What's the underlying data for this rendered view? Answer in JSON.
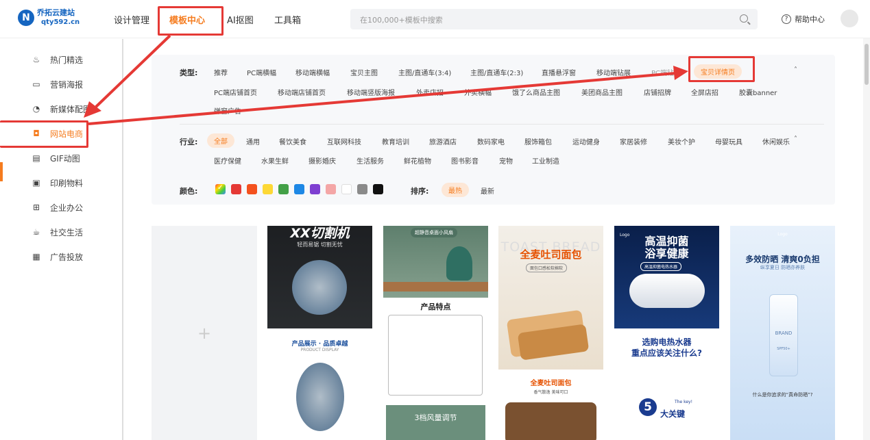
{
  "header": {
    "logo_name": "乔拓云建站",
    "logo_url": "qty592.cn",
    "nav": [
      "设计管理",
      "模板中心",
      "AI抠图",
      "工具箱"
    ],
    "search_placeholder": "在100,000+模板中搜索",
    "help_label": "帮助中心"
  },
  "sidebar": {
    "items": [
      {
        "label": "热门精选",
        "icon": "fire-icon"
      },
      {
        "label": "营销海报",
        "icon": "poster-icon"
      },
      {
        "label": "新媒体配图",
        "icon": "chat-icon"
      },
      {
        "label": "网站电商",
        "icon": "shop-icon"
      },
      {
        "label": "GIF动图",
        "icon": "gif-icon"
      },
      {
        "label": "印刷物料",
        "icon": "print-icon"
      },
      {
        "label": "企业办公",
        "icon": "office-icon"
      },
      {
        "label": "社交生活",
        "icon": "social-icon"
      },
      {
        "label": "广告投放",
        "icon": "ad-icon"
      }
    ],
    "active": "网站电商"
  },
  "filters": {
    "type_label": "类型:",
    "types_row1": [
      "推荐",
      "PC端横幅",
      "移动端横幅",
      "宝贝主图",
      "主图/直通车(3:4)",
      "主图/直通车(2:3)",
      "直播悬浮窗",
      "移动端钻展",
      "PC端钻展",
      "宝贝详情页"
    ],
    "types_row2": [
      "PC端店铺首页",
      "移动端店铺首页",
      "移动端竖版海报",
      "外卖店招",
      "外卖横幅",
      "饿了么商品主图",
      "美团商品主图",
      "店铺招牌",
      "全屏店招",
      "胶囊banner"
    ],
    "types_row3": [
      "弹窗广告"
    ],
    "type_selected": "宝贝详情页",
    "industry_label": "行业:",
    "industries_row1": [
      "全部",
      "通用",
      "餐饮美食",
      "互联网科技",
      "教育培训",
      "旅游酒店",
      "数码家电",
      "服饰箱包",
      "运动健身",
      "家居装修",
      "美妆个护",
      "母婴玩具",
      "休闲娱乐"
    ],
    "industries_row2": [
      "医疗保健",
      "水果生鲜",
      "摄影婚庆",
      "生活服务",
      "鲜花植物",
      "图书影音",
      "宠物",
      "工业制造"
    ],
    "industry_selected": "全部",
    "color_label": "颜色:",
    "colors": [
      "#e53935",
      "#f4511e",
      "#fdd835",
      "#43a047",
      "#1e88e5",
      "#7e3fd1",
      "#f4a6a6",
      "#ffffff",
      "#8a8a8a",
      "#111111"
    ],
    "sort_label": "排序:",
    "sort_options": [
      "最热",
      "最新"
    ],
    "sort_selected": "最热"
  },
  "templates": {
    "add_symbol": "+",
    "card1": {
      "title": "XX切割机",
      "subtitle": "轻而易锯 切割无忧",
      "section": "产品展示 · 品质卓越",
      "section_en": "PRODUCT DISPLAY"
    },
    "card2": {
      "badge": "超静音桌面小风扇",
      "heading": "产品特点",
      "band": "3档风量调节"
    },
    "card3": {
      "ghost": "TOAST BREAD",
      "title": "全麦吐司面包",
      "tag": "面包口感松软棉软",
      "title2": "全麦吐司面包",
      "desc": "香气散逸 美味可口"
    },
    "card4": {
      "logo": "Logo",
      "title1": "高温抑菌",
      "title2": "浴享健康",
      "tag": "高温抑菌电热水器",
      "q1": "选购电热水器",
      "q2": "重点应该关注什么?",
      "num": "5",
      "key": "大关键",
      "key_small": "The key!"
    },
    "card5": {
      "logo": "Logo",
      "title": "多效防晒 清爽0负担",
      "sub": "纵享夏日 防晒亦养肤",
      "brand": "BRAND",
      "spf": "SPF50+",
      "question": "什么是你追求的“真命防晒”?"
    }
  },
  "colors": {
    "accent": "#f57c1f",
    "annotation": "#e53935"
  }
}
